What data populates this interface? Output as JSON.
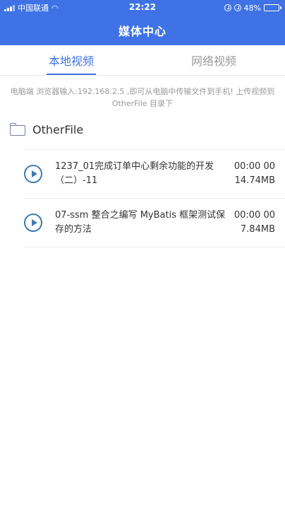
{
  "status_bar": {
    "carrier": "中国联通",
    "time": "22:22",
    "battery": "48%",
    "battery_level": 0.48
  },
  "header": {
    "title": "媒体中心"
  },
  "tabs": [
    {
      "label": "本地视频",
      "active": true
    },
    {
      "label": "网络视频",
      "active": false
    }
  ],
  "hint": "电脑端 浏览器输入:192.168.2.5 ,即可从电脑中传输文件到手机! 上传视频到 OtherFile 目录下",
  "folder": {
    "name": "OtherFile"
  },
  "videos": [
    {
      "title": "1237_01完成订单中心剩余功能的开发（二）-11",
      "duration": "00:00 00",
      "size": "14.74MB"
    },
    {
      "title": "07-ssm 整合之编写 MyBatis 框架测试保存的方法",
      "duration": "00:00 00",
      "size": "7.84MB"
    }
  ],
  "colors": {
    "accent": "#3f73e5",
    "play_icon": "#3d7ab3"
  }
}
